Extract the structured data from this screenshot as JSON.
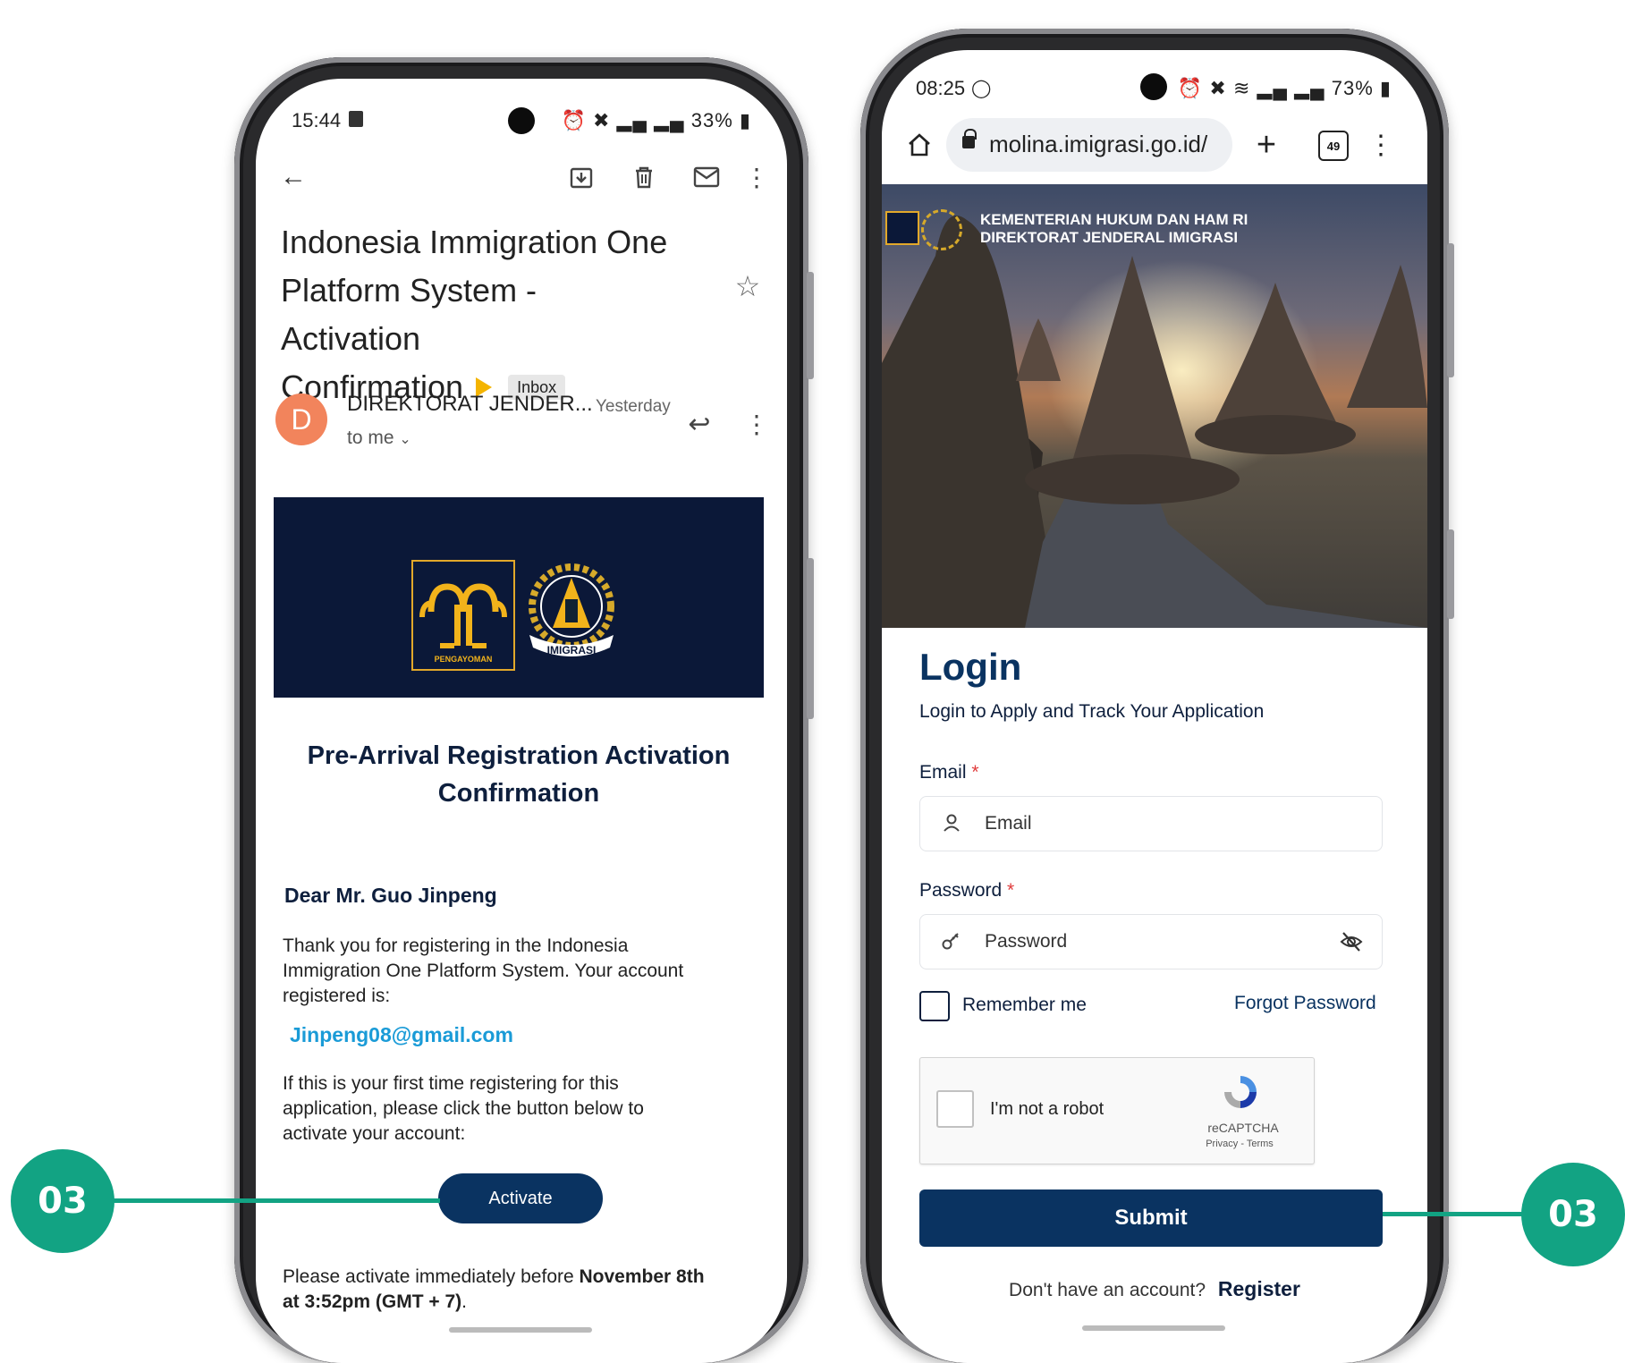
{
  "email_phone": {
    "status": {
      "time": "15:44",
      "right": "33%"
    },
    "subject": [
      "Indonesia Immigration One",
      "Platform System - Activation",
      "Confirmation"
    ],
    "inbox_badge": "Inbox",
    "sender": {
      "avatar_letter": "D",
      "name": "DIREKTORAT JENDER...",
      "when": "Yesterday",
      "to": "to me"
    },
    "banner": {
      "logo_left_text": "PENGAYOMAN",
      "logo_right_text": "IMIGRASI"
    },
    "heading": [
      "Pre-Arrival Registration Activation",
      "Confirmation"
    ],
    "greeting": "Dear Mr. Guo Jinpeng",
    "para1": [
      "Thank you for registering in the Indonesia",
      "Immigration One Platform System. Your account",
      "registered is:"
    ],
    "email_link": "Jinpeng08@gmail.com",
    "para2": [
      "If this is your first time registering for this",
      "application, please click the button below to",
      "activate your account:"
    ],
    "activate_label": "Activate",
    "deadline_prefix": "Please activate immediately before ",
    "deadline_bold1": "November 8th",
    "deadline_bold2": "at 3:52pm (GMT + 7)",
    "deadline_suffix": "."
  },
  "login_phone": {
    "status": {
      "time": "08:25",
      "right": "73%"
    },
    "url": "molina.imigrasi.go.id/",
    "tab_count": "49",
    "ministry_line1": "KEMENTERIAN HUKUM DAN HAM RI",
    "ministry_line2": "DIREKTORAT JENDERAL IMIGRASI",
    "title": "Login",
    "subtitle": "Login to Apply and Track Your Application",
    "email_label": "Email",
    "email_placeholder": "Email",
    "password_label": "Password",
    "password_placeholder": "Password",
    "required_mark": "*",
    "remember_label": "Remember me",
    "forgot_label": "Forgot Password",
    "captcha_label": "I'm not a robot",
    "captcha_brand": "reCAPTCHA",
    "captcha_links": "Privacy - Terms",
    "submit_label": "Submit",
    "no_account_text": "Don't have an account?",
    "register_label": "Register"
  },
  "callouts": {
    "left": "03",
    "right": "03"
  },
  "colors": {
    "callout": "#12a383",
    "navy": "#0a3361",
    "banner": "#0b1838",
    "link": "#1a9bd7",
    "avatar": "#f2845c"
  }
}
